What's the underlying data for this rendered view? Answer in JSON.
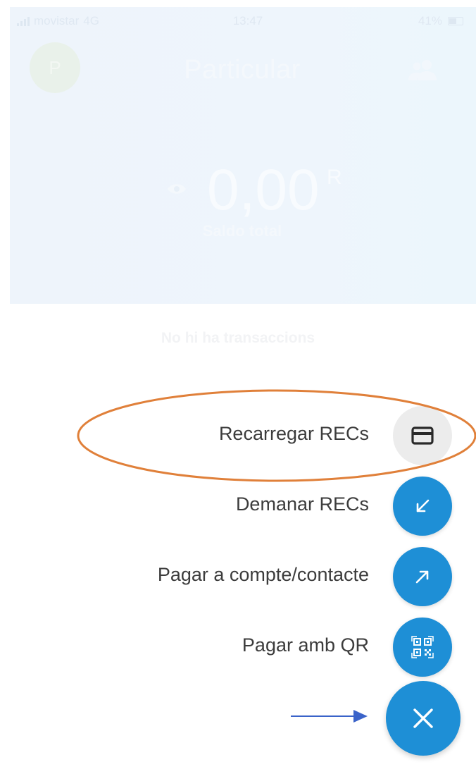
{
  "status_bar": {
    "carrier": "movistar",
    "network": "4G",
    "time": "13:47",
    "battery": "41%"
  },
  "header": {
    "avatar_initial": "P",
    "account_title": "Particular",
    "balance_value": "0,00",
    "currency_symbol": "R",
    "balance_label": "Saldo total"
  },
  "transactions": {
    "empty_message": "No hi ha transaccions"
  },
  "actions": [
    {
      "label": "Recarregar RECs",
      "icon": "credit-card-icon",
      "style": "grey"
    },
    {
      "label": "Demanar RECs",
      "icon": "arrow-down-left-icon",
      "style": "blue"
    },
    {
      "label": "Pagar a compte/contacte",
      "icon": "arrow-up-right-icon",
      "style": "blue"
    },
    {
      "label": "Pagar amb QR",
      "icon": "qr-code-icon",
      "style": "blue"
    }
  ],
  "close_button": {
    "icon": "close-icon"
  },
  "colors": {
    "accent": "#1e8fd6",
    "annotation_ellipse": "#e0803a",
    "annotation_arrow": "#3a63c9"
  }
}
